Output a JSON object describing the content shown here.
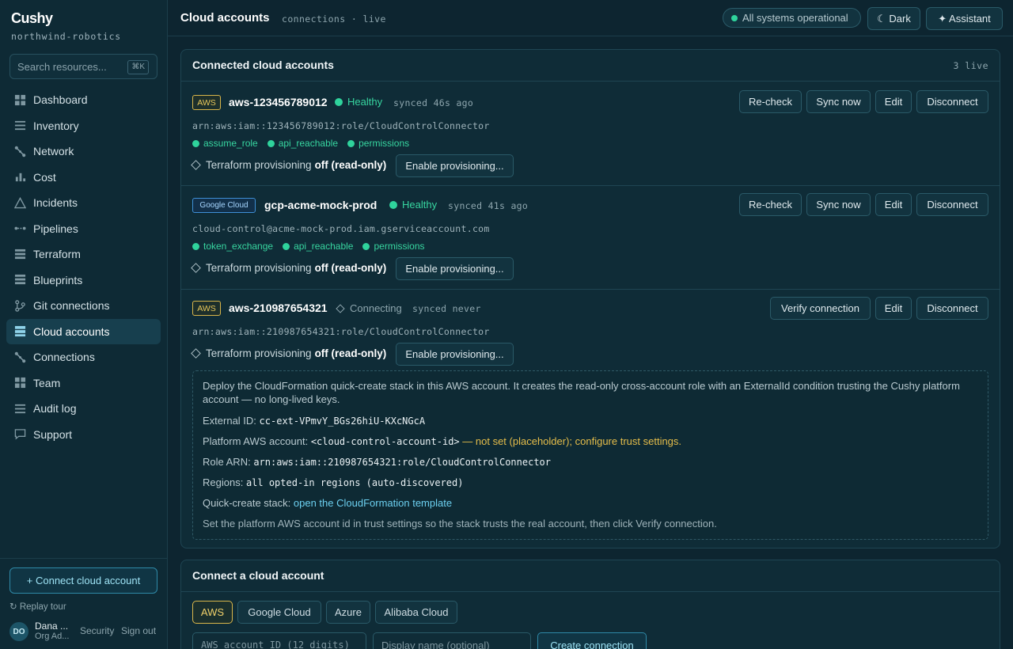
{
  "app": {
    "logo": "Cushy",
    "org": "northwind-robotics"
  },
  "search": {
    "placeholder": "Search resources...",
    "shortcut": "⌘K"
  },
  "nav": [
    {
      "label": "Dashboard",
      "icon": "grid-icon"
    },
    {
      "label": "Inventory",
      "icon": "list-icon"
    },
    {
      "label": "Network",
      "icon": "network-icon"
    },
    {
      "label": "Cost",
      "icon": "bar-chart-icon"
    },
    {
      "label": "Incidents",
      "icon": "warning-triangle-icon"
    },
    {
      "label": "Pipelines",
      "icon": "pipeline-icon"
    },
    {
      "label": "Terraform",
      "icon": "layers-icon"
    },
    {
      "label": "Blueprints",
      "icon": "stack-icon"
    },
    {
      "label": "Git connections",
      "icon": "git-branch-icon"
    },
    {
      "label": "Cloud accounts",
      "icon": "database-icon",
      "active": true
    },
    {
      "label": "Connections",
      "icon": "network-icon"
    },
    {
      "label": "Team",
      "icon": "grid-icon"
    },
    {
      "label": "Audit log",
      "icon": "list-icon"
    },
    {
      "label": "Support",
      "icon": "chat-icon"
    }
  ],
  "sidebar_footer": {
    "connect_label": "+ Connect cloud account",
    "replay_label": "Replay tour",
    "avatar_initials": "DO",
    "user_name": "Dana ...",
    "user_role": "Org Ad...",
    "security_label": "Security",
    "signout_label": "Sign out"
  },
  "header": {
    "title": "Cloud accounts",
    "subtitle": "connections · live",
    "status": "All systems operational",
    "theme_label": "☾ Dark",
    "assistant_label": "✦ Assistant"
  },
  "connected": {
    "title": "Connected cloud accounts",
    "count": "3 live",
    "accounts": [
      {
        "provider": "AWS",
        "name": "aws-123456789012",
        "health": "Healthy",
        "synced": "synced 46s ago",
        "arn": "arn:aws:iam::123456789012:role/CloudControlConnector",
        "checks": [
          "assume_role",
          "api_reachable",
          "permissions"
        ],
        "tf_label": "Terraform provisioning",
        "tf_state": "off (read-only)",
        "enable_label": "Enable provisioning...",
        "actions": [
          "Re-check",
          "Sync now",
          "Edit",
          "Disconnect"
        ]
      },
      {
        "provider": "Google Cloud",
        "name": "gcp-acme-mock-prod",
        "health": "Healthy",
        "synced": "synced 41s ago",
        "arn": "cloud-control@acme-mock-prod.iam.gserviceaccount.com",
        "checks": [
          "token_exchange",
          "api_reachable",
          "permissions"
        ],
        "tf_label": "Terraform provisioning",
        "tf_state": "off (read-only)",
        "enable_label": "Enable provisioning...",
        "actions": [
          "Re-check",
          "Sync now",
          "Edit",
          "Disconnect"
        ]
      },
      {
        "provider": "AWS",
        "name": "aws-210987654321",
        "health": "Connecting",
        "synced": "synced never",
        "arn": "arn:aws:iam::210987654321:role/CloudControlConnector",
        "tf_label": "Terraform provisioning",
        "tf_state": "off (read-only)",
        "enable_label": "Enable provisioning...",
        "actions": [
          "Verify connection",
          "Edit",
          "Disconnect"
        ]
      }
    ],
    "instructions": {
      "intro": "Deploy the CloudFormation quick-create stack in this AWS account. It creates the read-only cross-account role with an ExternalId condition trusting the Cushy platform account — no long-lived keys.",
      "external_id_label": "External ID:",
      "external_id": "cc-ext-VPmvY_BGs26hiU-KXcNGcA",
      "platform_label": "Platform AWS account:",
      "platform_value": "<cloud-control-account-id>",
      "platform_warning": "— not set (placeholder); configure trust settings.",
      "role_label": "Role ARN:",
      "role_value": "arn:aws:iam::210987654321:role/CloudControlConnector",
      "regions_label": "Regions:",
      "regions_value": "all opted-in regions (auto-discovered)",
      "quick_label": "Quick-create stack:",
      "quick_link": "open the CloudFormation template",
      "footer": "Set the platform AWS account id in trust settings so the stack trusts the real account, then click Verify connection."
    }
  },
  "connect": {
    "title": "Connect a cloud account",
    "providers": [
      "AWS",
      "Google Cloud",
      "Azure",
      "Alibaba Cloud"
    ],
    "account_placeholder": "AWS account ID (12 digits)",
    "name_placeholder": "Display name (optional)",
    "create_label": "Create connection"
  },
  "colors": {
    "accent": "#2fd39c",
    "warning": "#e5bd4a",
    "aws": "#d9b64a",
    "gcp": "#3e8fd6",
    "background": "#0d2530"
  }
}
